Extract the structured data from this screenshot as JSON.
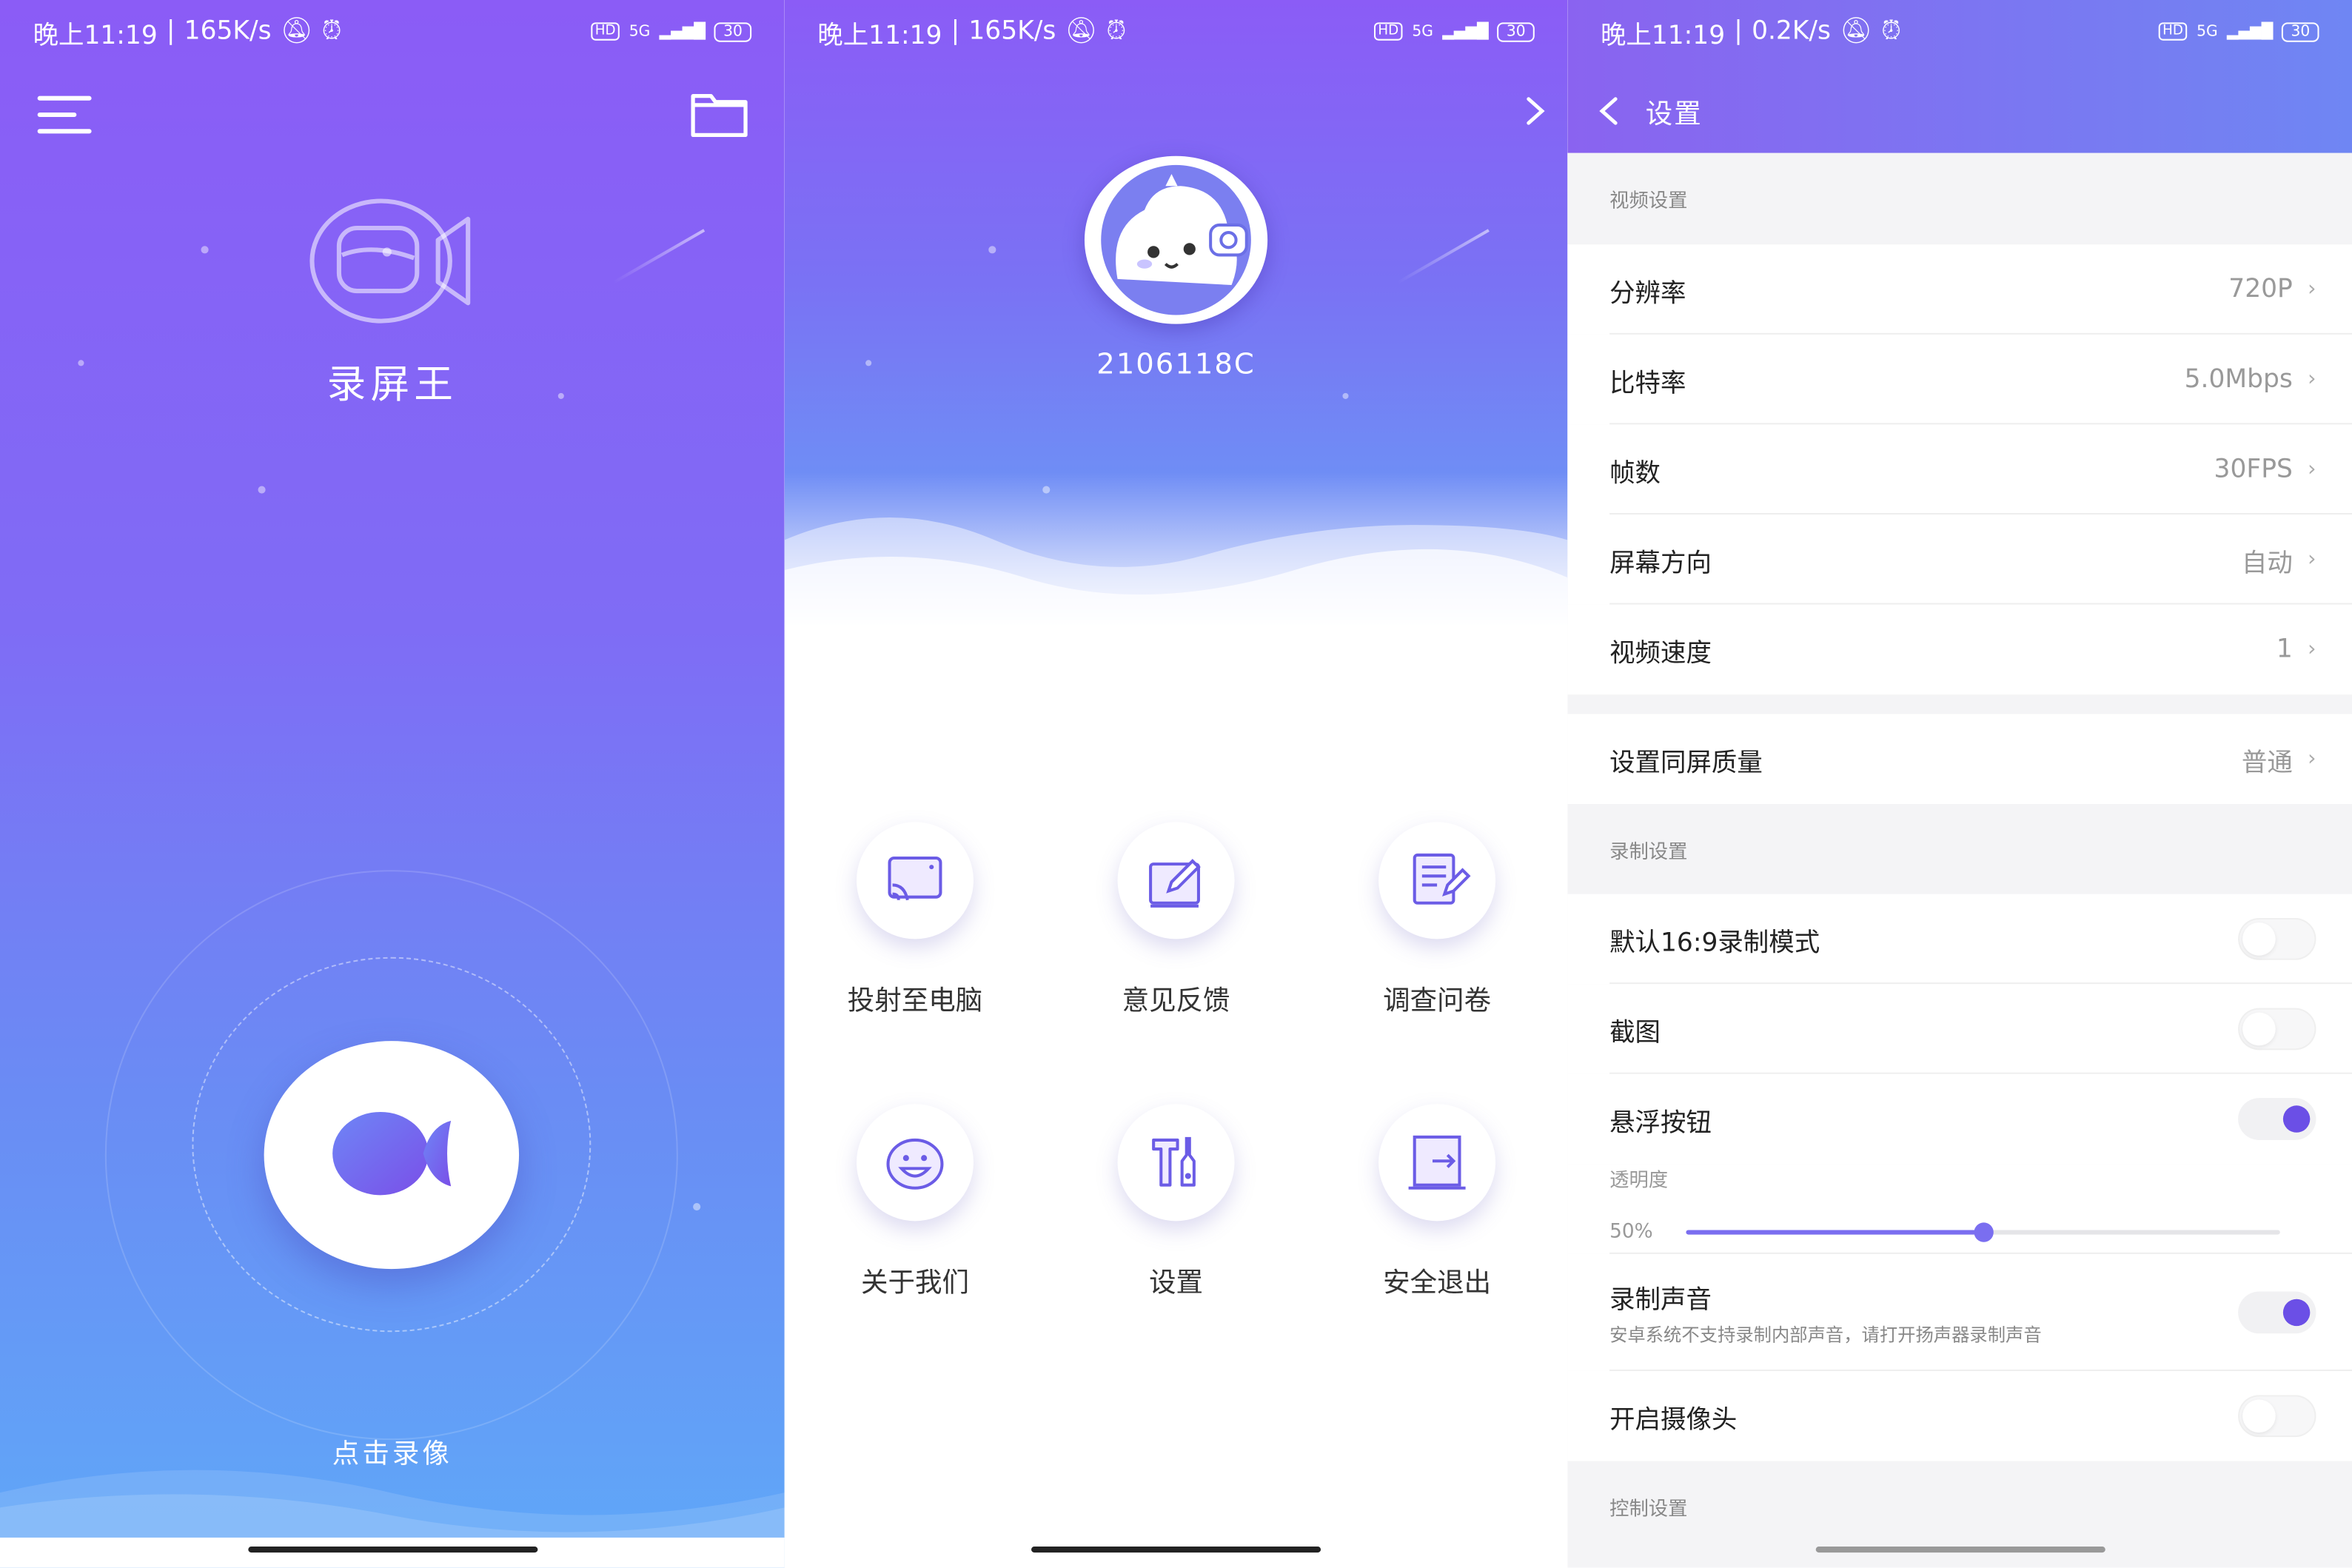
{
  "status_bars": [
    {
      "time": "晚上11:19",
      "speed": "165K/s",
      "hd": "HD",
      "net": "5G",
      "battery": "30"
    },
    {
      "time": "晚上11:19",
      "speed": "165K/s",
      "hd": "HD",
      "net": "5G",
      "battery": "30"
    },
    {
      "time": "晚上11:19",
      "speed": "0.2K/s",
      "hd": "HD",
      "net": "5G",
      "battery": "30"
    }
  ],
  "home": {
    "app_title": "录屏王",
    "record_label": "点击录像",
    "icons": {
      "menu": "hamburger-menu-icon",
      "folder": "folder-icon",
      "logo": "video-camera-icon"
    }
  },
  "profile": {
    "user_id": "2106118C",
    "grid": [
      {
        "label": "投射至电脑",
        "icon": "cast-screen-icon"
      },
      {
        "label": "意见反馈",
        "icon": "feedback-edit-icon"
      },
      {
        "label": "调查问卷",
        "icon": "survey-icon"
      },
      {
        "label": "关于我们",
        "icon": "smile-face-icon"
      },
      {
        "label": "设置",
        "icon": "tools-icon"
      },
      {
        "label": "安全退出",
        "icon": "exit-door-icon"
      }
    ]
  },
  "settings": {
    "title": "设置",
    "sections": {
      "video": "视频设置",
      "record": "录制设置",
      "control": "控制设置"
    },
    "video_rows": [
      {
        "label": "分辨率",
        "value": "720P"
      },
      {
        "label": "比特率",
        "value": "5.0Mbps"
      },
      {
        "label": "帧数",
        "value": "30FPS"
      },
      {
        "label": "屏幕方向",
        "value": "自动"
      },
      {
        "label": "视频速度",
        "value": "1"
      }
    ],
    "mirror_row": {
      "label": "设置同屏质量",
      "value": "普通"
    },
    "record_rows": [
      {
        "label": "默认16:9录制模式",
        "on": false
      },
      {
        "label": "截图",
        "on": false
      },
      {
        "label": "悬浮按钮",
        "on": true
      }
    ],
    "opacity": {
      "label": "透明度",
      "value_text": "50%",
      "value": 0.5
    },
    "audio_row": {
      "label": "录制声音",
      "note": "安卓系统不支持录制内部声音，请打开扬声器录制声音",
      "on": true
    },
    "camera_row": {
      "label": "开启摄像头",
      "on": false
    },
    "chevron": "›",
    "colors": {
      "accent": "#6b4fe6",
      "header_start": "#8a63f0",
      "header_end": "#6f86f3"
    }
  }
}
